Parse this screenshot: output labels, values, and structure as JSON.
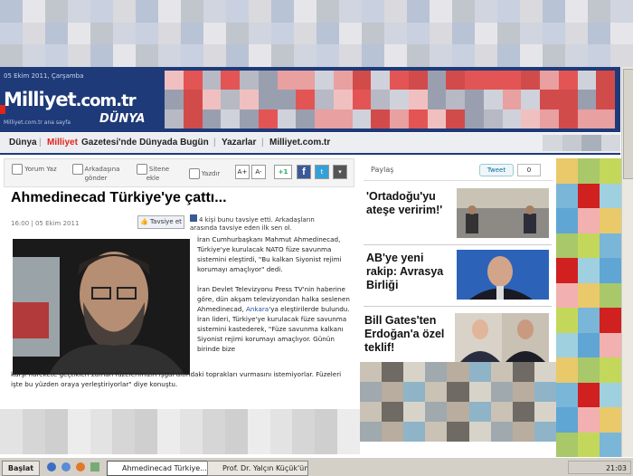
{
  "header": {
    "date": "05 Ekim 2011, Çarşamba",
    "logo": "Milliyet",
    "logo_domain": ".com.tr",
    "section": "DÜNYA",
    "home_link": "Milliyet.com.tr ana sayfa"
  },
  "nav": {
    "items": [
      "Dünya",
      "Milliyet",
      "Gazetesi'nde Dünyada Bugün",
      "Yazarlar",
      "Milliyet.com.tr"
    ]
  },
  "toolbar": {
    "comment": "Yorum Yaz",
    "send": "Arkadaşına gönder",
    "add": "Sitene ekle",
    "print": "Yazdır",
    "font_up": "A+",
    "font_down": "A-",
    "plus_one": "+1",
    "facebook": "f",
    "twitter": "t"
  },
  "article": {
    "title": "Ahmedinecad Türkiye'ye çattı...",
    "meta": "16:00 | 05 Ekim 2011",
    "like_button": "Tavsiye et",
    "like_count": "4 kişi bunu tavsiye etti. Arkadaşların arasında tavsiye eden ilk sen ol.",
    "p1": "İran Cumhurbaşkanı Mahmut Ahmedinecad, Türkiye'ye kurulacak NATO füze savunma sistemini eleştirdi, \"Bu kalkan Siyonist rejimi korumayı amaçlıyor\" dedi.",
    "p2a": "İran Devlet Televizyonu Press TV'nin haberine göre, dün akşam televizyondan halka seslenen Ahmedinecad,",
    "p2_link": "Ankara",
    "p2b": "'ya eleştirilerde bulundu. İran lideri, Türkiye'ye kurulacak füze savunma sistemini kastederek, \"Füze savunma kalkanı Siyonist rejimi korumayı amaçlıyor. Günün birinde bize",
    "p2c": "karşı harekete geçtikleri zaman füzelerimizin işgal altındaki toprakları vurmasını istemiyorlar. Füzeleri işte bu yüzden oraya yerleştiriyorlar\" diye konuştu."
  },
  "share": {
    "label": "Paylaş",
    "tweet": "Tweet",
    "tweet_count": "0"
  },
  "related": [
    {
      "title": "'Ortadoğu'yu ateşe veririm!'"
    },
    {
      "title": "AB'ye yeni rakip: Avrasya Birliği"
    },
    {
      "title": "Bill Gates'ten Erdoğan'a özel teklif!"
    }
  ],
  "taskbar": {
    "start": "Başlat",
    "window1": "Ahmedinecad Türkiye...",
    "window2": "Prof. Dr. Yalçın Küçük'ün ...",
    "clock": "21:03"
  },
  "colors": {
    "brand_blue": "#1f3a78",
    "brand_red": "#e2231a",
    "link": "#1f4ea1"
  }
}
